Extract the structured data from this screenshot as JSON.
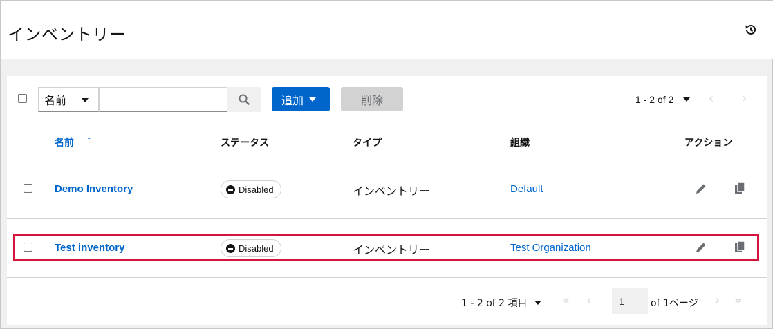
{
  "header": {
    "title": "インベントリー",
    "history_icon": "history-icon"
  },
  "toolbar": {
    "filter_field": "名前",
    "search_value": "",
    "add_label": "追加",
    "delete_label": "削除",
    "pagination": "1 - 2 of 2",
    "prev_arrow": "‹",
    "next_arrow": "›"
  },
  "table": {
    "columns": [
      "名前",
      "ステータス",
      "タイプ",
      "組織",
      "アクション"
    ],
    "sort_indicator": "↑",
    "rows": [
      {
        "name": "Demo Inventory",
        "status": "Disabled",
        "type": "インベントリー",
        "organization": "Default",
        "selected": false
      },
      {
        "name": "Test inventory",
        "status": "Disabled",
        "type": "インベントリー",
        "organization": "Test Organization",
        "selected": false
      }
    ]
  },
  "footer": {
    "count": "1 - 2 of 2 項目",
    "page": "1",
    "of_pages": "of 1ページ",
    "first_arrow": "«",
    "prev_arrow": "‹",
    "next_arrow": "›",
    "last_arrow": "»"
  },
  "colors": {
    "accent": "#0066cc",
    "highlight": "#d4143c"
  }
}
